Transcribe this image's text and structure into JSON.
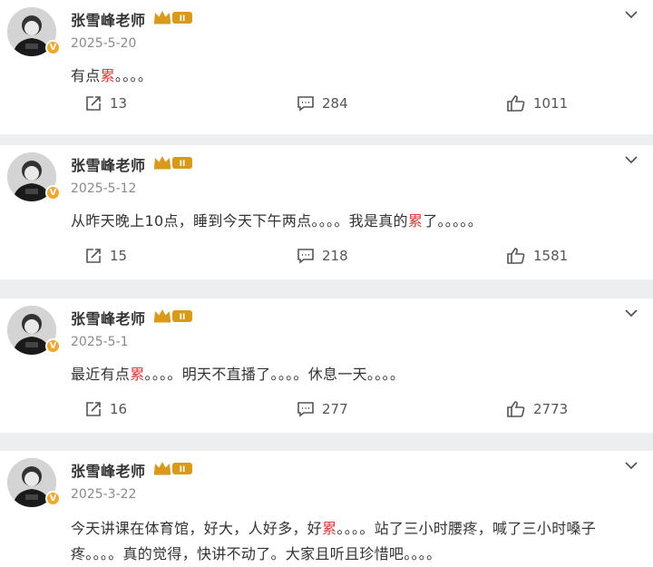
{
  "posts": [
    {
      "author": "张雪峰老师",
      "vip_badge": "II",
      "date": "2025-5-20",
      "text_parts": [
        "有点",
        "累",
        "。。。。",
        "",
        ""
      ],
      "forward_count": "13",
      "comment_count": "284",
      "like_count": "1011"
    },
    {
      "author": "张雪峰老师",
      "vip_badge": "II",
      "date": "2025-5-12",
      "text_parts": [
        "从昨天晚上10点，睡到今天下午两点。。。。我是真的",
        "累",
        "了。。。。。",
        "",
        ""
      ],
      "forward_count": "15",
      "comment_count": "218",
      "like_count": "1581"
    },
    {
      "author": "张雪峰老师",
      "vip_badge": "II",
      "date": "2025-5-1",
      "text_parts": [
        "最近有点",
        "累",
        "。。。。明天不直播了。。。。休息一天。。。。",
        "",
        ""
      ],
      "forward_count": "16",
      "comment_count": "277",
      "like_count": "2773"
    },
    {
      "author": "张雪峰老师",
      "vip_badge": "II",
      "date": "2025-3-22",
      "text_parts": [
        "今天讲课在体育馆，好大，人好多，好",
        "累",
        "。。。。站了三小时腰疼，喊了三小时嗓子疼。。。。真的觉得，快讲不动了。大家且听且珍惜吧。。。。",
        "",
        ""
      ]
    }
  ],
  "icons": {
    "verified": "verified-badge-icon",
    "vip": "crown-vip-icon",
    "menu": "chevron-down-icon",
    "forward": "share-icon",
    "comment": "comment-icon",
    "like": "thumbs-up-icon"
  },
  "colors": {
    "highlight": "#e23c3c",
    "verified": "#f5a623",
    "vip_gold": "#d99a1a"
  }
}
